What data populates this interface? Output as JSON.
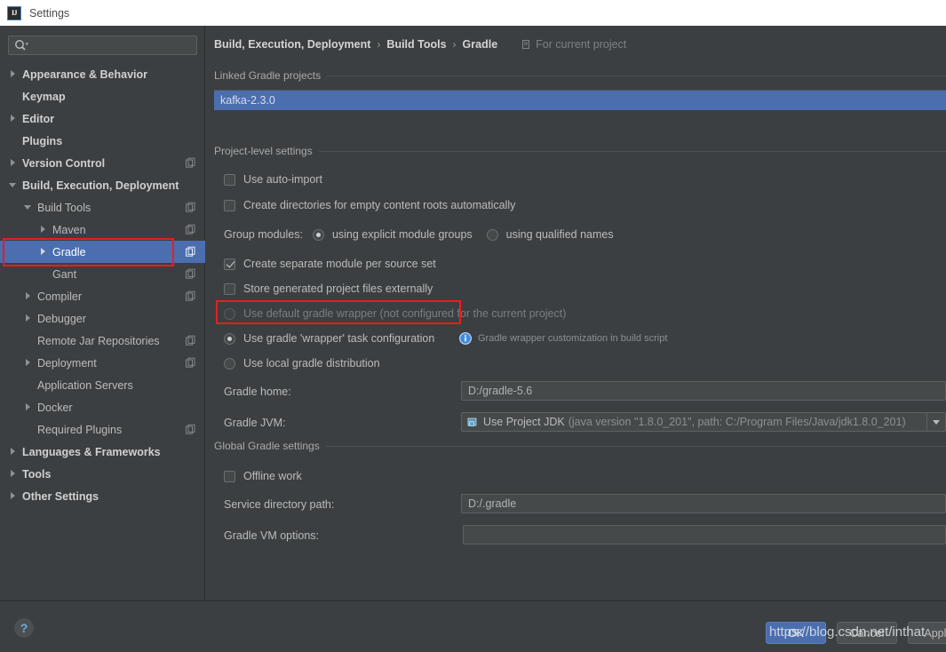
{
  "window": {
    "title": "Settings",
    "logo_text": "IJ"
  },
  "search": {
    "value": "",
    "placeholder": "",
    "icon": "search-icon"
  },
  "sidebar": {
    "items": [
      {
        "label": "Appearance & Behavior",
        "indent": 0,
        "arrow": "right",
        "bold": true,
        "selected": false,
        "project_icon": false
      },
      {
        "label": "Keymap",
        "indent": 0,
        "arrow": "none",
        "bold": true,
        "selected": false,
        "project_icon": false
      },
      {
        "label": "Editor",
        "indent": 0,
        "arrow": "right",
        "bold": true,
        "selected": false,
        "project_icon": false
      },
      {
        "label": "Plugins",
        "indent": 0,
        "arrow": "none",
        "bold": true,
        "selected": false,
        "project_icon": false
      },
      {
        "label": "Version Control",
        "indent": 0,
        "arrow": "right",
        "bold": true,
        "selected": false,
        "project_icon": true
      },
      {
        "label": "Build, Execution, Deployment",
        "indent": 0,
        "arrow": "down",
        "bold": true,
        "selected": false,
        "project_icon": false
      },
      {
        "label": "Build Tools",
        "indent": 1,
        "arrow": "down",
        "bold": false,
        "selected": false,
        "project_icon": true
      },
      {
        "label": "Maven",
        "indent": 2,
        "arrow": "right",
        "bold": false,
        "selected": false,
        "project_icon": true
      },
      {
        "label": "Gradle",
        "indent": 2,
        "arrow": "right",
        "bold": false,
        "selected": true,
        "project_icon": true
      },
      {
        "label": "Gant",
        "indent": 2,
        "arrow": "none",
        "bold": false,
        "selected": false,
        "project_icon": true
      },
      {
        "label": "Compiler",
        "indent": 1,
        "arrow": "right",
        "bold": false,
        "selected": false,
        "project_icon": true
      },
      {
        "label": "Debugger",
        "indent": 1,
        "arrow": "right",
        "bold": false,
        "selected": false,
        "project_icon": false
      },
      {
        "label": "Remote Jar Repositories",
        "indent": 1,
        "arrow": "none",
        "bold": false,
        "selected": false,
        "project_icon": true
      },
      {
        "label": "Deployment",
        "indent": 1,
        "arrow": "right",
        "bold": false,
        "selected": false,
        "project_icon": true
      },
      {
        "label": "Application Servers",
        "indent": 1,
        "arrow": "none",
        "bold": false,
        "selected": false,
        "project_icon": false
      },
      {
        "label": "Docker",
        "indent": 1,
        "arrow": "right",
        "bold": false,
        "selected": false,
        "project_icon": false
      },
      {
        "label": "Required Plugins",
        "indent": 1,
        "arrow": "none",
        "bold": false,
        "selected": false,
        "project_icon": true
      },
      {
        "label": "Languages & Frameworks",
        "indent": 0,
        "arrow": "right",
        "bold": true,
        "selected": false,
        "project_icon": false
      },
      {
        "label": "Tools",
        "indent": 0,
        "arrow": "right",
        "bold": true,
        "selected": false,
        "project_icon": false
      },
      {
        "label": "Other Settings",
        "indent": 0,
        "arrow": "right",
        "bold": true,
        "selected": false,
        "project_icon": false
      }
    ]
  },
  "breadcrumb": {
    "crumbs": [
      "Build, Execution, Deployment",
      "Build Tools",
      "Gradle"
    ],
    "separator": "›",
    "for_current_project": "For current project"
  },
  "main": {
    "linked_projects": {
      "group_title": "Linked Gradle projects",
      "items": [
        "kafka-2.3.0"
      ]
    },
    "project_level": {
      "group_title": "Project-level settings",
      "use_auto_import": {
        "label": "Use auto-import",
        "checked": false
      },
      "create_directories": {
        "label": "Create directories for empty content roots automatically",
        "checked": false
      },
      "group_modules": {
        "label": "Group modules:",
        "options": [
          {
            "label": "using explicit module groups",
            "selected": true
          },
          {
            "label": "using qualified names",
            "selected": false
          }
        ]
      },
      "separate_module": {
        "label": "Create separate module per source set",
        "checked": true
      },
      "store_externally": {
        "label": "Store generated project files externally",
        "checked": false
      },
      "distribution": {
        "options": [
          {
            "label": "Use default gradle wrapper (not configured for the current project)",
            "selected": false,
            "disabled": true
          },
          {
            "label": "Use gradle 'wrapper' task configuration",
            "selected": true,
            "disabled": false
          },
          {
            "label": "Use local gradle distribution",
            "selected": false,
            "disabled": false
          }
        ],
        "hint": "Gradle wrapper customization in build script"
      },
      "gradle_home": {
        "label": "Gradle home:",
        "value": "D:/gradle-5.6"
      },
      "gradle_jvm": {
        "label": "Gradle JVM:",
        "value_main": "Use Project JDK",
        "value_detail": "(java version \"1.8.0_201\", path: C:/Program Files/Java/jdk1.8.0_201)"
      }
    },
    "global_settings": {
      "group_title": "Global Gradle settings",
      "offline_work": {
        "label": "Offline work",
        "checked": false
      },
      "service_directory": {
        "label": "Service directory path:",
        "value": "D:/.gradle"
      },
      "vm_options": {
        "label": "Gradle VM options:",
        "value": ""
      }
    }
  },
  "footer": {
    "help_label": "?",
    "ok_label": "OK",
    "cancel_label": "Cancel",
    "apply_label": "Apply"
  },
  "overlay": {
    "watermark": "https://blog.csdn.net/inthat"
  },
  "colors": {
    "selection_blue": "#4b6eaf",
    "annotation_red": "#ee1c1c",
    "panel_bg": "#3c3f41",
    "field_bg": "#45494a",
    "text": "#bbbbbb"
  }
}
